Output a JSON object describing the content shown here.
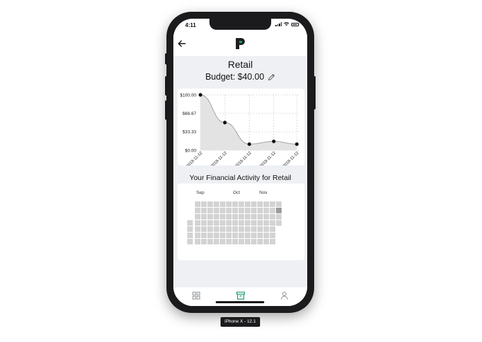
{
  "status_bar": {
    "time": "4:11"
  },
  "header": {
    "title": "Retail",
    "budget_label": "Budget: $40.00"
  },
  "chart_data": {
    "type": "line",
    "x": [
      "2019-11-12",
      "2019-11-12",
      "2019-11-12",
      "2019-11-12",
      "2019-11-12"
    ],
    "series": [
      {
        "values": [
          100,
          50,
          11,
          16,
          11
        ]
      }
    ],
    "ylim": [
      0,
      100
    ],
    "y_ticks": [
      "$0.00",
      "$33.33",
      "$66.67",
      "$100.00"
    ],
    "grid": true,
    "color": "#111111",
    "fill": "#e3e3e3"
  },
  "activity": {
    "title": "Your Financial Activity for Retail",
    "months": [
      "Sep",
      "Oct",
      "Nov"
    ],
    "cell_color": "#d3d3d3",
    "active_color": "#9a9a9a",
    "active_level": 1
  },
  "tabs": [
    {
      "icon": "grid-icon"
    },
    {
      "icon": "archive-icon",
      "active": true
    },
    {
      "icon": "user-icon"
    }
  ],
  "device_label": "iPhone X - 12.1",
  "colors": {
    "brand": "#1f9e6b",
    "background": "#eef0f3"
  }
}
